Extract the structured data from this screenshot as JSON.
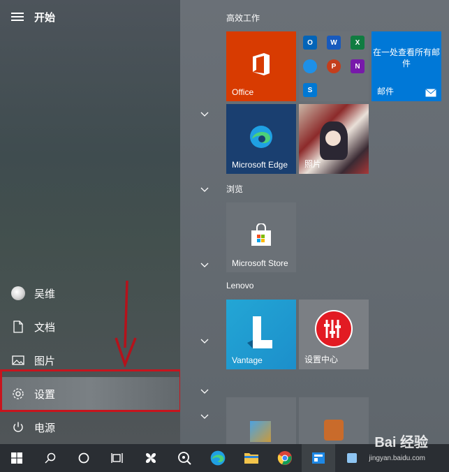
{
  "start_menu": {
    "title": "开始",
    "nav": [
      {
        "label": "吴维",
        "icon": "user-avatar-icon"
      },
      {
        "label": "文档",
        "icon": "document-icon"
      },
      {
        "label": "图片",
        "icon": "picture-icon"
      },
      {
        "label": "设置",
        "icon": "gear-icon"
      },
      {
        "label": "电源",
        "icon": "power-icon"
      }
    ]
  },
  "groups": {
    "productivity": "高效工作",
    "browse": "浏览",
    "lenovo": "Lenovo"
  },
  "tiles": {
    "office": "Office",
    "mail_title": "在一处查看所有邮件",
    "mail": "邮件",
    "edge": "Microsoft Edge",
    "photos": "照片",
    "store": "Microsoft Store",
    "vantage": "Vantage",
    "settings_center": "设置中心"
  },
  "watermark": {
    "text": "Bai 经验",
    "sub": "jingyan.baidu.com"
  },
  "colors": {
    "office": "#d83b01",
    "mail": "#0078d7",
    "edge": "#1a3f70",
    "vantage": "#23a6d5",
    "highlight": "#c8141d",
    "arrow": "#b5121b"
  }
}
